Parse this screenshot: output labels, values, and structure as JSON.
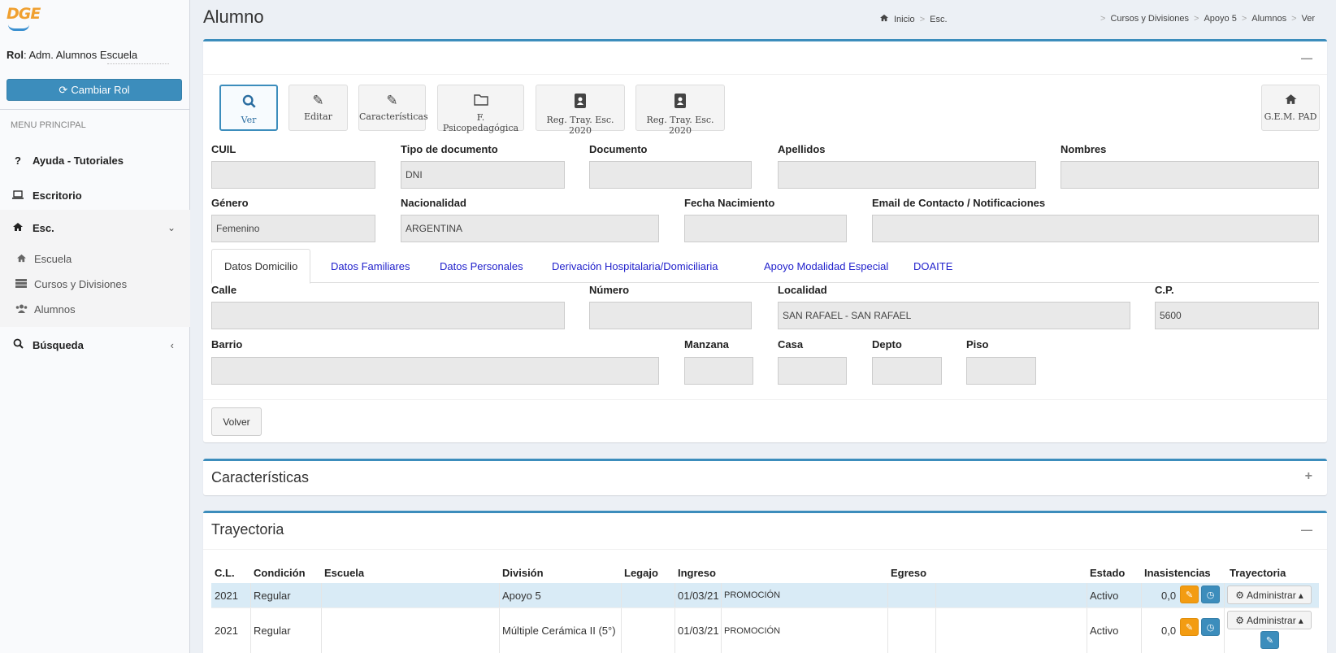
{
  "sidebar": {
    "logo_text": "DGE",
    "rol_label": "Rol",
    "rol_value": ": Adm. Alumnos Escuela",
    "cambiar_rol": "Cambiar Rol",
    "menu_header": "MENU PRINCIPAL",
    "items": [
      {
        "label": "Ayuda - Tutoriales",
        "icon": "question-icon"
      },
      {
        "label": "Escritorio",
        "icon": "laptop-icon"
      },
      {
        "label": "Esc.",
        "icon": "home-icon"
      },
      {
        "label": "Búsqueda",
        "icon": "search-icon"
      }
    ],
    "submenu": [
      {
        "label": "Escuela",
        "icon": "home-icon"
      },
      {
        "label": "Cursos y Divisiones",
        "icon": "list-icon"
      },
      {
        "label": "Alumnos",
        "icon": "users-icon"
      }
    ]
  },
  "header": {
    "title": "Alumno",
    "breadcrumb": [
      "Inicio",
      "Esc.",
      "Cursos y Divisiones",
      "Apoyo 5",
      "Alumnos",
      "Ver"
    ]
  },
  "toolbar": {
    "buttons": [
      "Ver",
      "Editar",
      "Características",
      "F. Psicopedagógica",
      "Reg. Tray. Esc. 2020",
      "Reg. Tray. Esc. 2020"
    ],
    "gem": "G.E.M. PAD"
  },
  "form": {
    "labels": {
      "cuil": "CUIL",
      "tipo_doc": "Tipo de documento",
      "documento": "Documento",
      "apellidos": "Apellidos",
      "nombres": "Nombres",
      "genero": "Género",
      "nacionalidad": "Nacionalidad",
      "fecha_nac": "Fecha Nacimiento",
      "email": "Email de Contacto / Notificaciones",
      "calle": "Calle",
      "numero": "Número",
      "localidad": "Localidad",
      "cp": "C.P.",
      "barrio": "Barrio",
      "manzana": "Manzana",
      "casa": "Casa",
      "depto": "Depto",
      "piso": "Piso"
    },
    "values": {
      "cuil": "",
      "tipo_doc": "DNI",
      "documento": "",
      "apellidos": "",
      "nombres": "",
      "genero": "Femenino",
      "nacionalidad": "ARGENTINA",
      "fecha_nac": "",
      "email": "",
      "calle": "",
      "numero": "",
      "localidad": "SAN RAFAEL - SAN RAFAEL",
      "cp": "5600",
      "barrio": "",
      "manzana": "",
      "casa": "",
      "depto": "",
      "piso": ""
    }
  },
  "tabs": [
    "Datos Domicilio",
    "Datos Familiares",
    "Datos Personales",
    "Derivación Hospitalaria/Domiciliaria",
    "Apoyo Modalidad Especial",
    "DOAITE"
  ],
  "volver": "Volver",
  "caracteristicas_title": "Características",
  "trayectoria": {
    "title": "Trayectoria",
    "columns": [
      "C.L.",
      "Condición",
      "Escuela",
      "División",
      "Legajo",
      "Ingreso",
      "Egreso",
      "Estado",
      "Inasistencias",
      "Trayectoria"
    ],
    "rows": [
      {
        "cl": "2021",
        "condicion": "Regular",
        "escuela": "",
        "division": "Apoyo 5",
        "legajo": "",
        "ingreso": "01/03/21",
        "motivo": "PROMOCIÓN",
        "egreso": "",
        "estado": "Activo",
        "inasistencias": "0,0",
        "accion": "Administrar"
      },
      {
        "cl": "2021",
        "condicion": "Regular",
        "escuela": "",
        "division": "Múltiple Cerámica II (5°)",
        "legajo": "",
        "ingreso": "01/03/21",
        "motivo": "PROMOCIÓN",
        "egreso": "",
        "estado": "Activo",
        "inasistencias": "0,0",
        "accion": "Administrar"
      }
    ]
  },
  "colors": {
    "accent": "#3c8dbc",
    "orange": "#f39c12",
    "highlight_row": "#d9ebf6"
  }
}
